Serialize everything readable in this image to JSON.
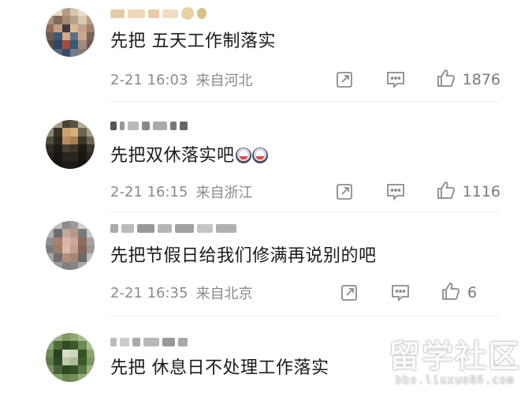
{
  "comments": [
    {
      "content": "先把 五天工作制落实",
      "time": "2-21 16:03",
      "location": "来自河北",
      "likes": "1876",
      "icons": {
        "share": "share-icon",
        "comment": "comment-icon",
        "like": "thumb-up-icon"
      }
    },
    {
      "content": "先把双休落实吧",
      "time": "2-21 16:15",
      "location": "来自浙江",
      "likes": "1116",
      "emojis": [
        "crying-face-emoji",
        "crying-face-emoji"
      ]
    },
    {
      "content": "先把节假日给我们修满再说别的吧",
      "time": "2-21 16:35",
      "location": "来自北京",
      "likes": "6"
    },
    {
      "content": "先把 休息日不处理工作落实"
    }
  ],
  "watermark": {
    "title": "留学社区",
    "url": "bbs.liuxue86.com"
  },
  "colors": {
    "background": "#ffffff",
    "text": "#1a1a1a",
    "meta": "#8a8a8a"
  }
}
